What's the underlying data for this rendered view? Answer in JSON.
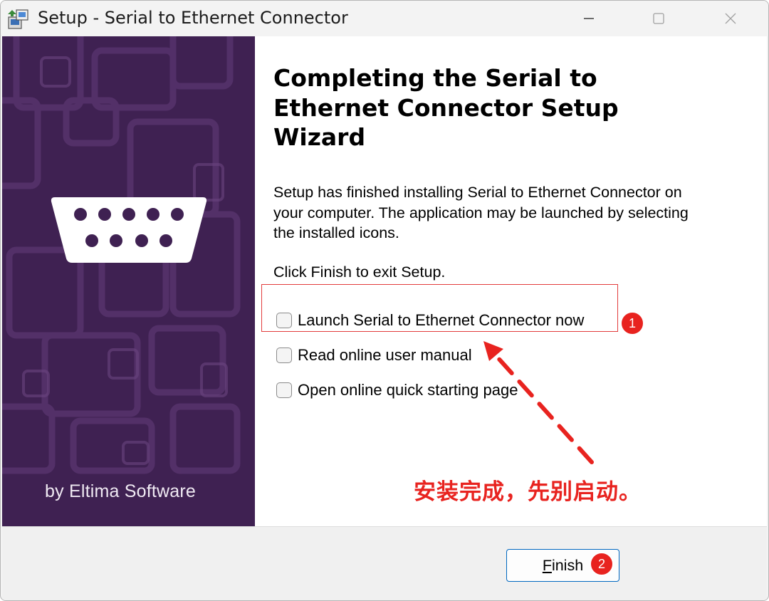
{
  "window": {
    "title": "Setup - Serial to Ethernet Connector",
    "controls": [
      "minimize-icon",
      "maximize-icon",
      "close-icon"
    ]
  },
  "banner": {
    "byline": "by Eltima Software",
    "icon": "serial-port-connector-icon",
    "background_color": "#3f2152"
  },
  "page": {
    "heading": "Completing the Serial to\nEthernet Connector Setup\nWizard",
    "description": "Setup has finished installing Serial to Ethernet Connector on\nyour computer. The application may be launched by selecting\nthe installed icons.",
    "exit_hint": "Click Finish to exit Setup.",
    "options": [
      {
        "label": "Launch Serial to Ethernet Connector now",
        "checked": false
      },
      {
        "label": "Read online user manual",
        "checked": false
      },
      {
        "label": "Open online quick starting page",
        "checked": false
      }
    ]
  },
  "footer": {
    "finish_mnemonic": "F",
    "finish_rest": "inish"
  },
  "annotations": {
    "badge_1": "1",
    "badge_2": "2",
    "note": "安装完成，先别启动。",
    "color": "#e8231f"
  }
}
